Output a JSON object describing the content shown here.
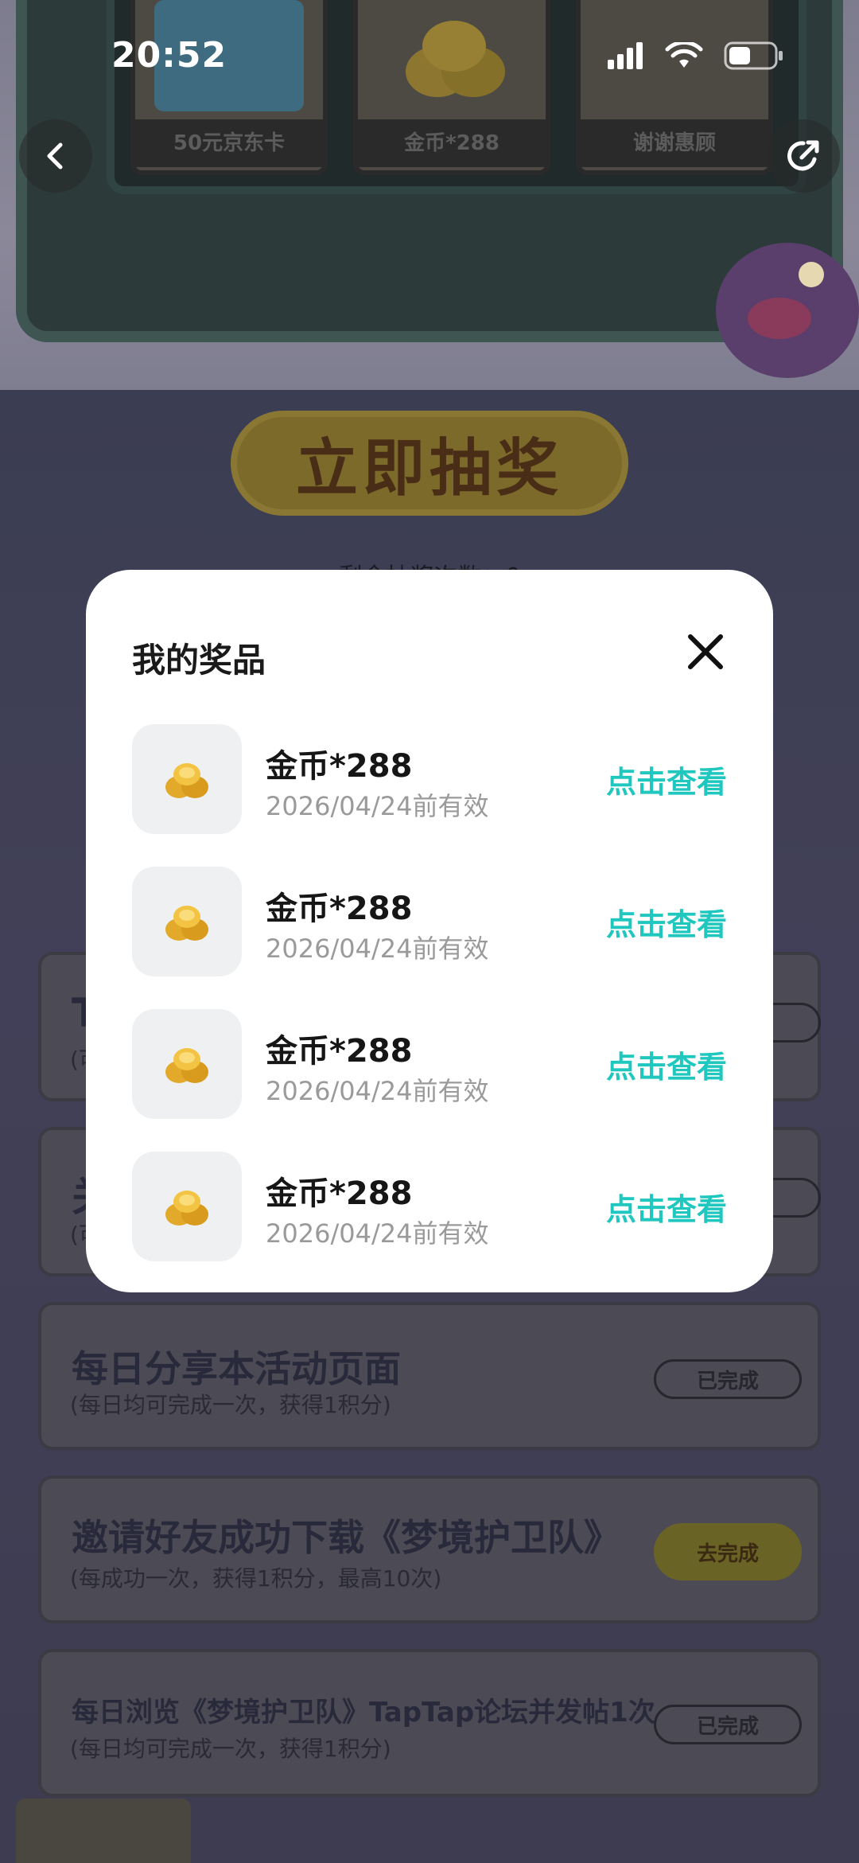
{
  "status_bar": {
    "time": "20:52"
  },
  "machine": {
    "slots": [
      {
        "label": "50元京东卡"
      },
      {
        "label": "金币*288"
      },
      {
        "label": "谢谢惠顾"
      }
    ]
  },
  "main": {
    "draw_button": "立即抽奖",
    "remaining": "剩余抽奖次数：0"
  },
  "tasks": [
    {
      "title": "T",
      "sub": "(可",
      "button": ""
    },
    {
      "title": "关",
      "sub": "(可",
      "button": ""
    },
    {
      "title": "每日分享本活动页面",
      "sub": "(每日均可完成一次，获得1积分)",
      "button": "已完成"
    },
    {
      "title": "邀请好友成功下载《梦境护卫队》",
      "sub": "(每成功一次，获得1积分，最高10次)",
      "button": "去完成"
    },
    {
      "title": "每日浏览《梦境护卫队》TapTap论坛并发帖1次",
      "sub": "(每日均可完成一次，获得1积分)",
      "button": "已完成"
    }
  ],
  "modal": {
    "title": "我的奖品",
    "prizes": [
      {
        "name": "金币*288",
        "valid": "2026/04/24前有效",
        "action": "点击查看"
      },
      {
        "name": "金币*288",
        "valid": "2026/04/24前有效",
        "action": "点击查看"
      },
      {
        "name": "金币*288",
        "valid": "2026/04/24前有效",
        "action": "点击查看"
      },
      {
        "name": "金币*288",
        "valid": "2026/04/24前有效",
        "action": "点击查看"
      }
    ]
  },
  "colors": {
    "accent": "#1fc7bf",
    "overlay": "#3d3f55",
    "modal_bg": "#ffffff"
  },
  "icons": [
    "back-arrow-icon",
    "share-icon",
    "close-icon",
    "gold-coins-icon",
    "signal-icon",
    "wifi-icon",
    "battery-icon"
  ]
}
